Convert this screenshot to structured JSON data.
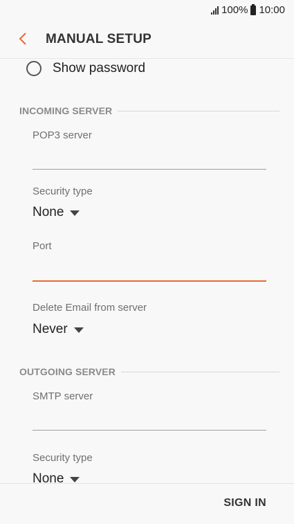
{
  "status_bar": {
    "battery": "100%",
    "time": "10:00"
  },
  "app_bar": {
    "title": "MANUAL SETUP"
  },
  "show_password": {
    "label": "Show password",
    "checked": false
  },
  "incoming": {
    "header": "INCOMING SERVER",
    "server_label": "POP3 server",
    "server_value": "",
    "security_label": "Security type",
    "security_value": "None",
    "port_label": "Port",
    "port_value": "",
    "delete_label": "Delete Email from server",
    "delete_value": "Never"
  },
  "outgoing": {
    "header": "OUTGOING SERVER",
    "server_label": "SMTP server",
    "server_value": "",
    "security_label": "Security type",
    "security_value": "None"
  },
  "footer": {
    "signin_label": "SIGN IN"
  },
  "colors": {
    "accent": "#e86a33",
    "background": "#f8f8f8"
  },
  "icons": {
    "back": "chevron-left-icon",
    "signal": "signal-icon",
    "battery": "battery-icon",
    "dropdown": "caret-down-icon"
  }
}
